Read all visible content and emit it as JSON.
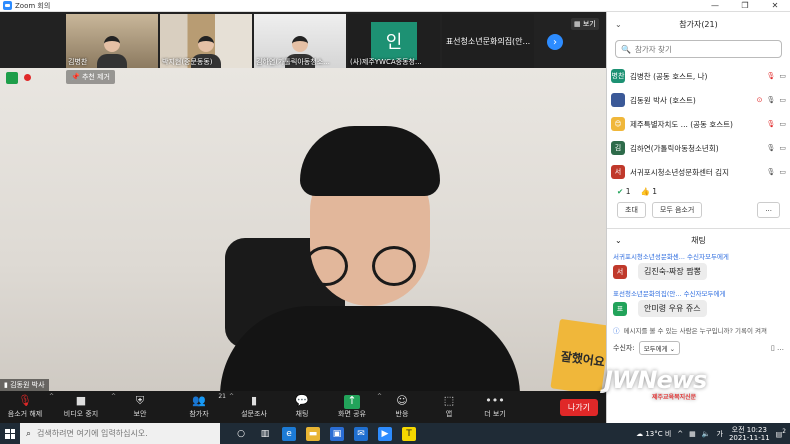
{
  "window": {
    "title": "Zoom 회의",
    "buttons": [
      "—",
      "❐",
      "✕"
    ]
  },
  "strip": {
    "thumbnails": [
      {
        "name": "김병찬"
      },
      {
        "name": "박지현(중문동동)"
      },
      {
        "name": "김하연(가톨릭아동청소..."
      },
      {
        "name": "(사)제주YWCA중동청...",
        "initial": "인"
      },
      {
        "name": "표선청소년문화의집(안..."
      }
    ],
    "view_label": "보기"
  },
  "main": {
    "unpin_label": "추천 제거",
    "speaker": "김동원 박사",
    "book_text": "잘했어요"
  },
  "toolbar": {
    "items": [
      {
        "label": "음소거 해제",
        "icon": "mic-muted-icon"
      },
      {
        "label": "비디오 중지",
        "icon": "video-icon"
      },
      {
        "label": "보안",
        "icon": "shield-icon"
      },
      {
        "label": "참가자",
        "icon": "participants-icon",
        "count": "21"
      },
      {
        "label": "설문조사",
        "icon": "poll-icon"
      },
      {
        "label": "채팅",
        "icon": "chat-icon"
      },
      {
        "label": "화면 공유",
        "icon": "share-screen-icon"
      },
      {
        "label": "반응",
        "icon": "reactions-icon"
      },
      {
        "label": "앱",
        "icon": "apps-icon"
      },
      {
        "label": "더 보기",
        "icon": "more-icon"
      }
    ],
    "leave_label": "나가기"
  },
  "participants": {
    "title": "참가자(21)",
    "search_placeholder": "참가자 찾기",
    "list": [
      {
        "avatar": "병찬",
        "color": "#1d9173",
        "name": "김병찬 (공동 호스트, 나)"
      },
      {
        "avatar": "",
        "color": "#3b5998",
        "name": "김동원 박사 (호스트)"
      },
      {
        "avatar": "😊",
        "color": "#f0b73a",
        "name": "제주특별자치도 ... (공동 호스트)"
      },
      {
        "avatar": "김",
        "color": "#2e6b4a",
        "name": "김하연(가톨릭아동청소년회)"
      },
      {
        "avatar": "서",
        "color": "#c0392b",
        "name": "서귀포시청소년성문화센터 김지"
      }
    ],
    "reactions": {
      "ok": "1",
      "thumbs": "1"
    },
    "actions": {
      "invite": "초대",
      "mute_all": "모두 음소거",
      "more": "..."
    }
  },
  "chat": {
    "title": "채팅",
    "messages": [
      {
        "system": "서귀포시청소년성문화센... 수신자모두에게",
        "avatar": "서",
        "color": "#c0392b",
        "text": "김진숙-짜장 짬뽕"
      },
      {
        "system": "표선청소년문화의집(안... 수신자모두에게",
        "avatar": "표",
        "color": "#22a35a",
        "text": "안미령 우유 쥬스"
      }
    ],
    "note": "메시지를 볼 수 있는 사람은 누구입니까? 기록이 켜져",
    "to_label": "수신자:",
    "to_value": "모두에게"
  },
  "taskbar": {
    "search_placeholder": "검색하려면 여기에 입력하십시오.",
    "weather": "13°C 비",
    "time": "오전 10:23",
    "date": "2021-11-11",
    "notifications": "2"
  },
  "watermark": {
    "text": "JWNews",
    "sub": "제주교육복지신문"
  }
}
